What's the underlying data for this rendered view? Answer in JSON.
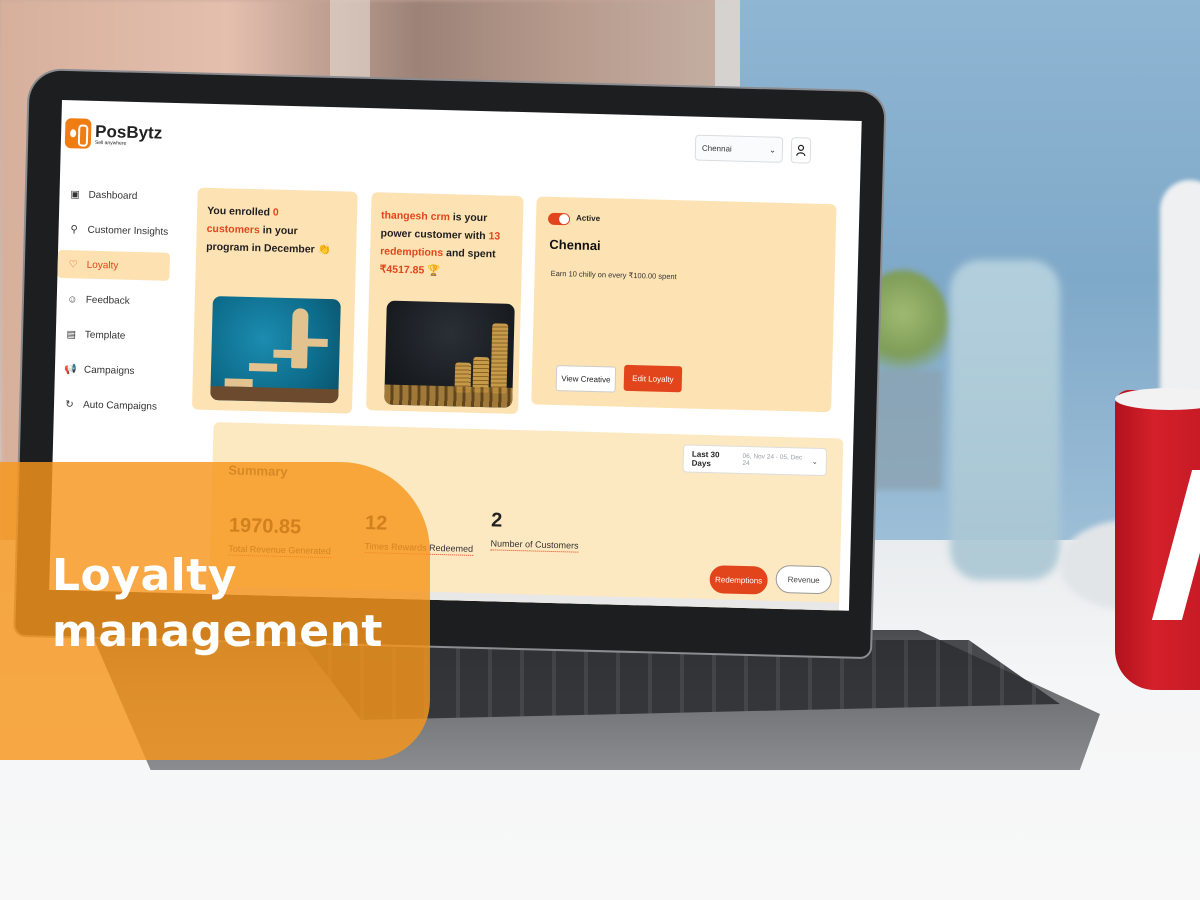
{
  "banner": {
    "title_line1": "Loyalty",
    "title_line2": "management"
  },
  "app": {
    "brand": {
      "name": "PosBytz",
      "tagline": "Sell anywhere",
      "accent_color": "#f07d14"
    },
    "header": {
      "location_select": {
        "value": "Chennai",
        "icon": "chevron-down-icon"
      },
      "user_button": {
        "icon": "user-icon"
      }
    },
    "sidebar": {
      "items": [
        {
          "label": "Dashboard",
          "icon": "dashboard-icon",
          "active": false
        },
        {
          "label": "Customer Insights",
          "icon": "user-icon",
          "active": false
        },
        {
          "label": "Loyalty",
          "icon": "heart-icon",
          "active": true
        },
        {
          "label": "Feedback",
          "icon": "smiley-icon",
          "active": false
        },
        {
          "label": "Template",
          "icon": "template-icon",
          "active": false
        },
        {
          "label": "Campaigns",
          "icon": "megaphone-icon",
          "active": false
        },
        {
          "label": "Auto Campaigns",
          "icon": "refresh-icon",
          "active": false
        }
      ]
    },
    "enrolled_card": {
      "t1": "You enrolled ",
      "count": "0",
      "t2": "customers",
      "t3": " in your program in December",
      "emoji": "👏"
    },
    "power_customer_card": {
      "customer_name": "thangesh crm",
      "t1": " is your power customer with ",
      "redemptions": "13 redemptions",
      "t2": " and spent ",
      "amount": "₹4517.85",
      "emoji": "🏆"
    },
    "program_card": {
      "status": "Active",
      "status_on": true,
      "title": "Chennai",
      "description": "Earn 10 chilly on every ₹100.00 spent",
      "view_button": "View Creative",
      "edit_button": "Edit Loyalty"
    },
    "summary": {
      "title": "Summary",
      "date_filter": {
        "label": "Last 30 Days",
        "range": "06, Nov 24 - 05, Dec 24"
      },
      "stats": [
        {
          "value": "1970.85",
          "label": "Total Revenue Generated"
        },
        {
          "value": "12",
          "label": "Times Rewards Redeemed"
        },
        {
          "value": "2",
          "label": "Number of Customers"
        }
      ],
      "toggle_buttons": [
        {
          "label": "Redemptions",
          "active": true
        },
        {
          "label": "Revenue",
          "active": false
        }
      ]
    },
    "colors": {
      "primary": "#e2451c",
      "card_bg": "#fde3b4",
      "active_nav_bg": "#fde1b1"
    }
  }
}
